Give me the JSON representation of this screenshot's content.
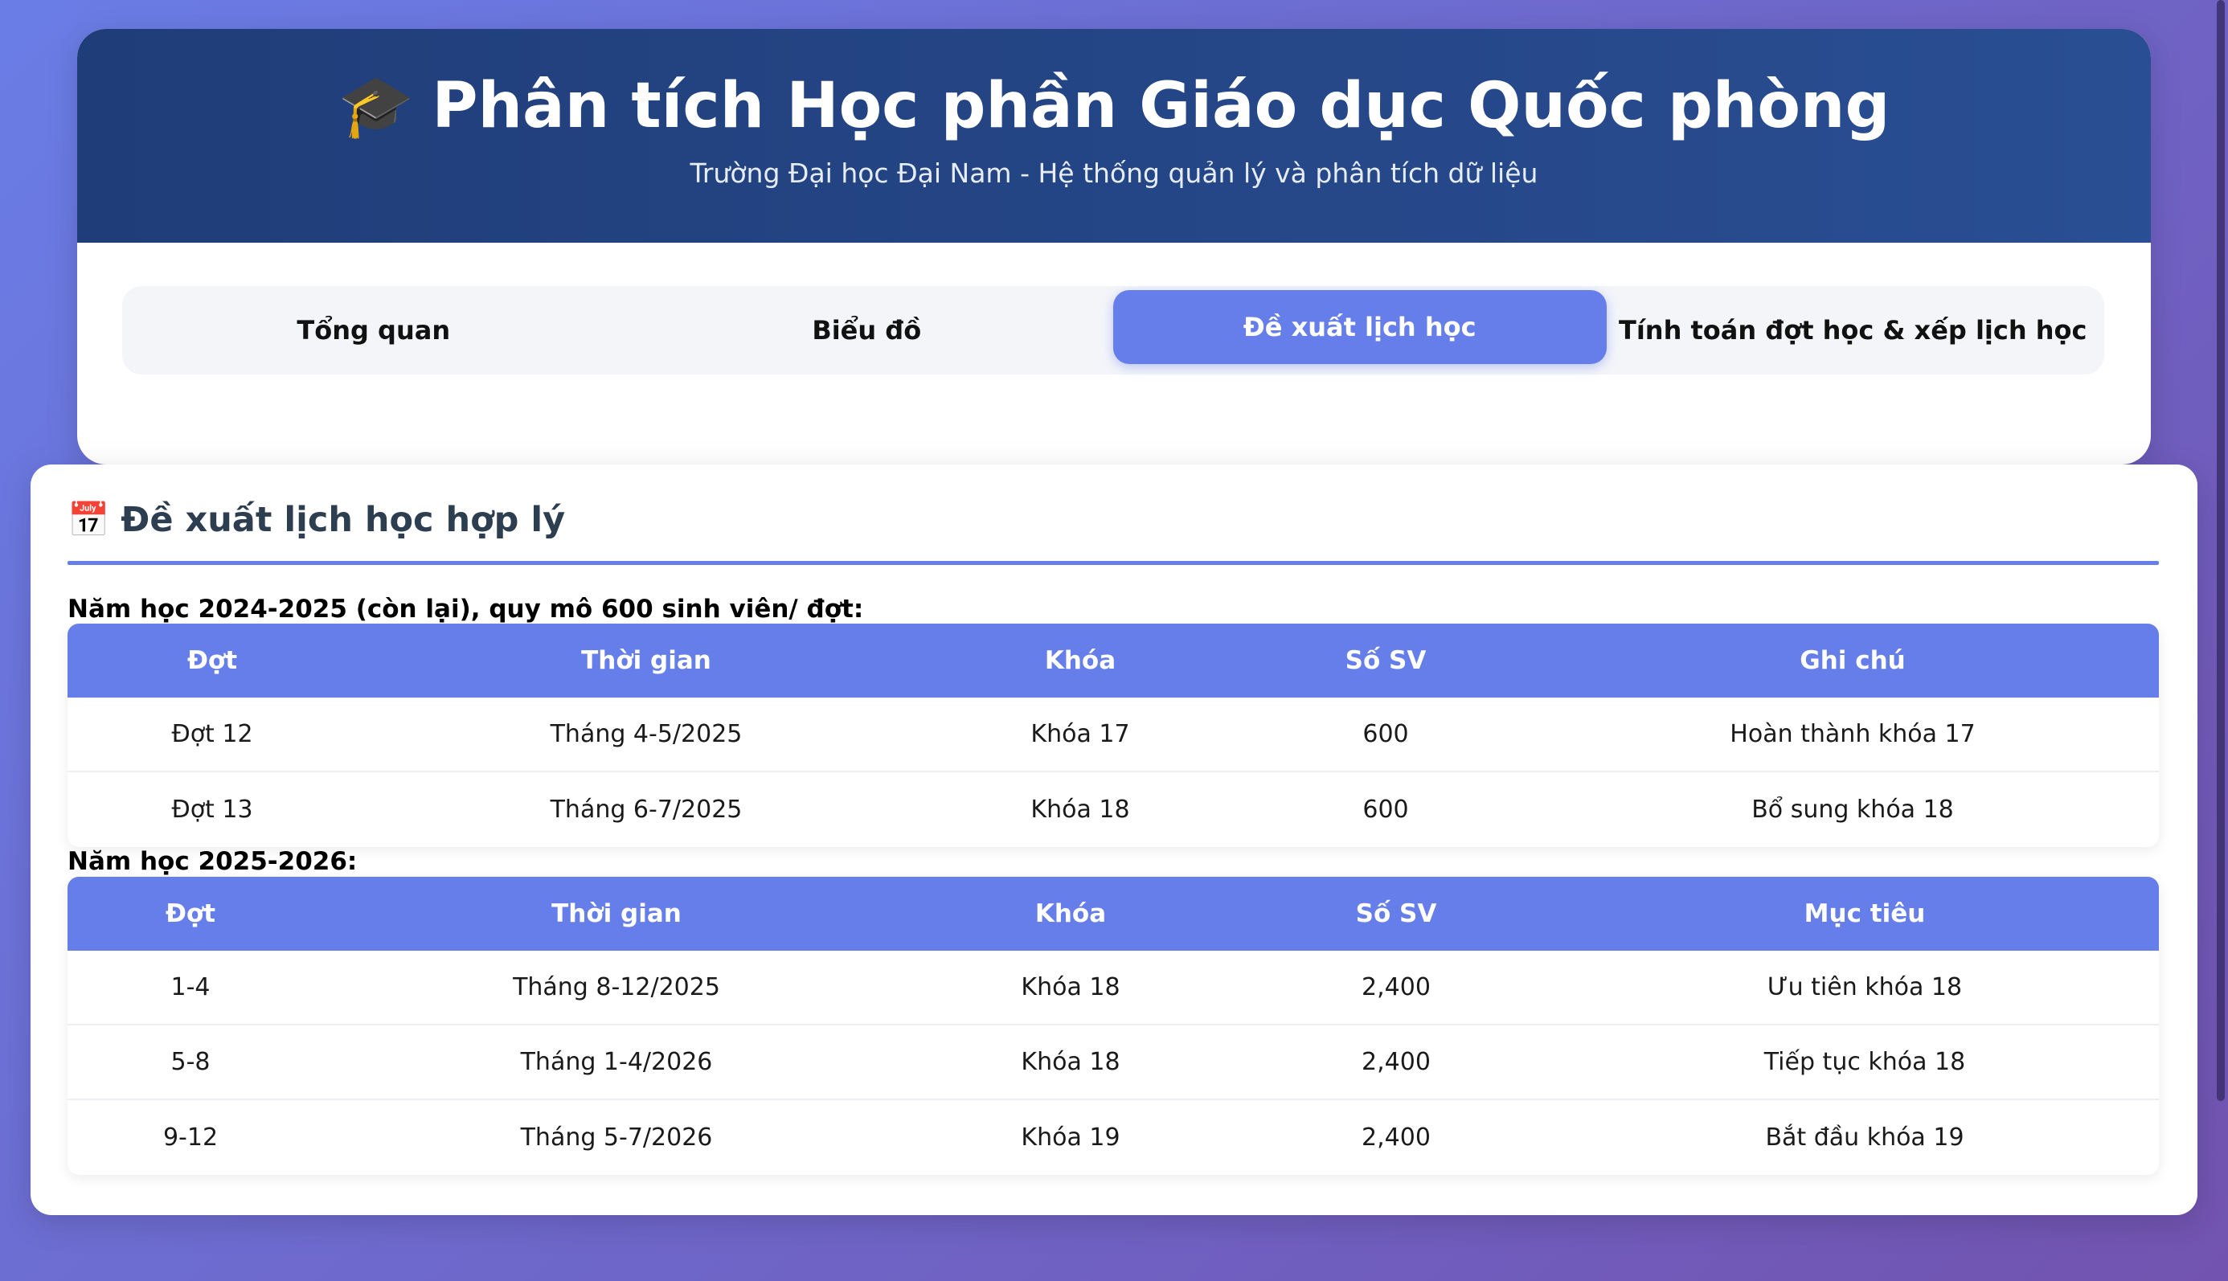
{
  "header": {
    "icon": "graduation-cap-icon",
    "title": "Phân tích Học phần Giáo dục Quốc phòng",
    "subtitle": "Trường Đại học Đại Nam - Hệ thống quản lý và phân tích dữ liệu"
  },
  "tabs": [
    {
      "label": "Tổng quan",
      "active": false
    },
    {
      "label": "Biểu đồ",
      "active": false
    },
    {
      "label": "Đề xuất lịch học",
      "active": true
    },
    {
      "label": "Tính toán đợt học & xếp lịch học",
      "active": false
    }
  ],
  "section": {
    "icon": "calendar-icon",
    "title": "Đề xuất lịch học hợp lý"
  },
  "table1": {
    "caption": "Năm học 2024-2025 (còn lại), quy mô 600 sinh viên/ đợt:",
    "headers": [
      "Đợt",
      "Thời gian",
      "Khóa",
      "Số SV",
      "Ghi chú"
    ],
    "rows": [
      [
        "Đợt 12",
        "Tháng 4-5/2025",
        "Khóa 17",
        "600",
        "Hoàn thành khóa 17"
      ],
      [
        "Đợt 13",
        "Tháng 6-7/2025",
        "Khóa 18",
        "600",
        "Bổ sung khóa 18"
      ]
    ]
  },
  "table2": {
    "caption": "Năm học 2025-2026:",
    "headers": [
      "Đợt",
      "Thời gian",
      "Khóa",
      "Số SV",
      "Mục tiêu"
    ],
    "rows": [
      [
        "1-4",
        "Tháng 8-12/2025",
        "Khóa 18",
        "2,400",
        "Ưu tiên khóa 18"
      ],
      [
        "5-8",
        "Tháng 1-4/2026",
        "Khóa 18",
        "2,400",
        "Tiếp tục khóa 18"
      ],
      [
        "9-12",
        "Tháng 5-7/2026",
        "Khóa 19",
        "2,400",
        "Bắt đầu khóa 19"
      ]
    ]
  },
  "colors": {
    "accent": "#667eea",
    "banner": "#1f3d78",
    "heading_text": "#2c3e50"
  }
}
